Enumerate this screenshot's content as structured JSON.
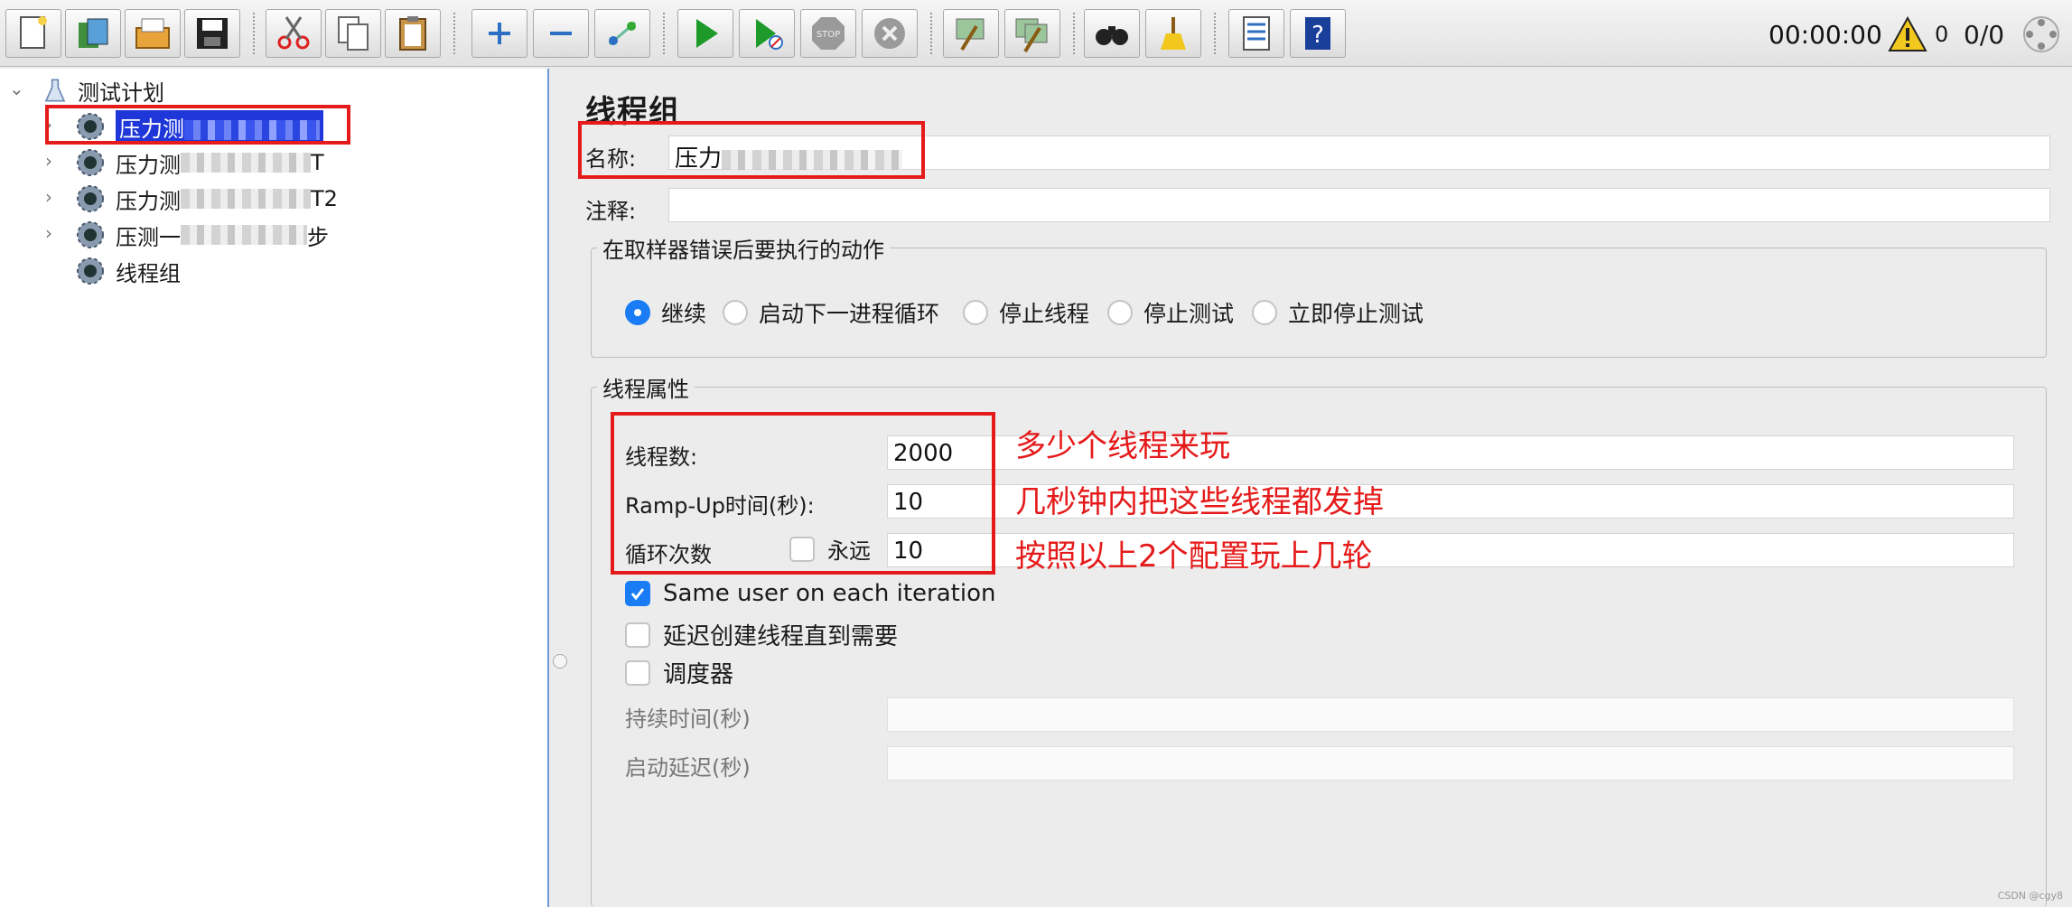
{
  "toolbar": {
    "buttons": [
      {
        "icon": "new-icon"
      },
      {
        "icon": "templates-icon"
      },
      {
        "icon": "open-icon"
      },
      {
        "icon": "save-icon"
      },
      {
        "icon": "cut-icon"
      },
      {
        "icon": "copy-icon"
      },
      {
        "icon": "paste-icon"
      },
      {
        "icon": "expand-icon"
      },
      {
        "icon": "collapse-icon"
      },
      {
        "icon": "toggle-icon"
      },
      {
        "icon": "start-icon"
      },
      {
        "icon": "start-no-pause-icon"
      },
      {
        "icon": "stop-icon"
      },
      {
        "icon": "shutdown-icon"
      },
      {
        "icon": "clear-icon"
      },
      {
        "icon": "clear-all-icon"
      },
      {
        "icon": "search-icon"
      },
      {
        "icon": "reset-search-icon"
      },
      {
        "icon": "function-helper-icon"
      },
      {
        "icon": "help-icon"
      }
    ],
    "timer": "00:00:00",
    "warning_count": "0",
    "thread_ratio": "0/0"
  },
  "tree": {
    "root": "测试计划",
    "items": [
      {
        "label": "压力测",
        "suffix": "",
        "selected": true
      },
      {
        "label": "压力测",
        "suffix": "T",
        "selected": false
      },
      {
        "label": "压力测",
        "suffix": "T2",
        "selected": false
      },
      {
        "label": "压测一",
        "suffix": "步",
        "selected": false
      },
      {
        "label": "线程组",
        "suffix": "",
        "selected": false
      }
    ]
  },
  "panel": {
    "title": "线程组",
    "name_label": "名称:",
    "name_value": "压力",
    "comment_label": "注释:",
    "comment_value": "",
    "error_action": {
      "legend": "在取样器错误后要执行的动作",
      "options": [
        "继续",
        "启动下一进程循环",
        "停止线程",
        "停止测试",
        "立即停止测试"
      ],
      "selected": "继续"
    },
    "thread_props": {
      "legend": "线程属性",
      "threads_label": "线程数:",
      "threads_value": "2000",
      "rampup_label": "Ramp-Up时间(秒):",
      "rampup_value": "10",
      "loop_label": "循环次数",
      "forever_label": "永远",
      "forever_checked": false,
      "loop_value": "10",
      "same_user_label": "Same user on each iteration",
      "same_user_checked": true,
      "delay_label": "延迟创建线程直到需要",
      "delay_checked": false,
      "scheduler_label": "调度器",
      "scheduler_checked": false,
      "duration_label": "持续时间(秒)",
      "duration_value": "",
      "startup_delay_label": "启动延迟(秒)",
      "startup_delay_value": ""
    }
  },
  "annotations": {
    "threads_note": "多少个线程来玩",
    "rampup_note": "几秒钟内把这些线程都发掉",
    "loop_note": "按照以上2个配置玩上几轮"
  },
  "watermark": "CSDN @cgy8",
  "colors": {
    "selection": "#1f37d8",
    "annotation": "#e51a1a",
    "accent": "#1a7cf5"
  }
}
